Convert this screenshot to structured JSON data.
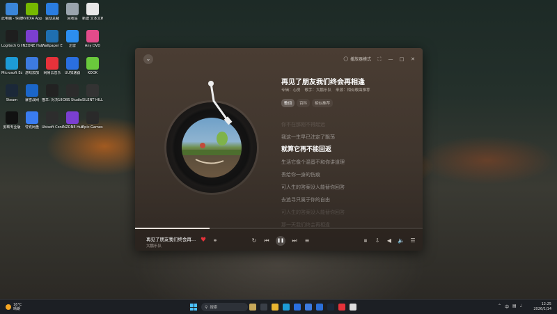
{
  "desktop": {
    "icons": [
      {
        "label": "此电脑 - 快捷方式",
        "color": "#3a86d9"
      },
      {
        "label": "NVIDIA App",
        "color": "#76b900"
      },
      {
        "label": "驱动总裁",
        "color": "#2a7de1"
      },
      {
        "label": "回收站",
        "color": "#9aa4ad"
      },
      {
        "label": "新建 文本文档",
        "color": "#e8e8e8"
      },
      {
        "label": "Logitech G HUB",
        "color": "#1e1e1e"
      },
      {
        "label": "INZONE Hub",
        "color": "#7b3fd1"
      },
      {
        "label": "Wallpaper Engine",
        "color": "#1f6fb0"
      },
      {
        "label": "迅雷",
        "color": "#2c8ef0"
      },
      {
        "label": "Any DVD",
        "color": "#e34b8a"
      },
      {
        "label": "Microsoft Edge",
        "color": "#1d9bd6"
      },
      {
        "label": "游戏加加",
        "color": "#3d7be0"
      },
      {
        "label": "网易云音乐",
        "color": "#e6323a"
      },
      {
        "label": "UU加速器",
        "color": "#2a6fe0"
      },
      {
        "label": "KOOK",
        "color": "#6ac93c"
      },
      {
        "label": "Steam",
        "color": "#1b2838"
      },
      {
        "label": "暴雪战网",
        "color": "#1b66c9"
      },
      {
        "label": "猫羊: 对决1896",
        "color": "#222222"
      },
      {
        "label": "OBS Studio",
        "color": "#2b2b2b"
      },
      {
        "label": "SILENT HILL 2",
        "color": "#333333"
      },
      {
        "label": "剪映专业版",
        "color": "#111111"
      },
      {
        "label": "夸克网盘",
        "color": "#3a7cf0"
      },
      {
        "label": "Ubisoft Connect",
        "color": "#2d2d2d"
      },
      {
        "label": "INZONE Hub",
        "color": "#7b3fd1"
      },
      {
        "label": "Epic Games Launcher",
        "color": "#2a2a2a"
      }
    ]
  },
  "player": {
    "mode_label": "播放器模式",
    "song_title": "再见了朋友我们终会再相逢",
    "album_label": "专辑：心房",
    "artist_label": "歌手：大鹏乐队",
    "source_label": "来源：相似歌曲推荐",
    "tabs": [
      {
        "label": "歌词",
        "active": true
      },
      {
        "label": "百科",
        "active": false
      },
      {
        "label": "相似推荐",
        "active": false
      }
    ],
    "lyrics": [
      {
        "text": "你不在那刚不得起远",
        "state": "fade"
      },
      {
        "text": "我这一生早已注定了飘荡",
        "state": "dim"
      },
      {
        "text": "就算它再不能回返",
        "state": "current"
      },
      {
        "text": "生活它像个混蛋不和你讲道理",
        "state": "dim"
      },
      {
        "text": "丢给你一身的伤痕",
        "state": "dim"
      },
      {
        "text": "可人生的答案没人能替你回答",
        "state": "dim"
      },
      {
        "text": "去追寻只属于你的自由",
        "state": "dim"
      },
      {
        "text": "可人生的答案没人能替你回答",
        "state": "fade"
      },
      {
        "text": "那一天我们终会再相逢",
        "state": "fade"
      }
    ],
    "bar": {
      "title": "再见了朋友我们终会再...",
      "artist": "大鹏乐队",
      "progress": 0.26
    }
  },
  "taskbar": {
    "temperature": "16°C",
    "weather": "晴朗",
    "search_placeholder": "搜索",
    "time": "12:25",
    "date": "2026/1/14",
    "ime": "中",
    "app_colors": [
      "#c8a95a",
      "#3a3f48",
      "#e8b531",
      "#1d9bd6",
      "#2a6fe0",
      "#3d7be0",
      "#2b6fd8",
      "#1b2838",
      "#e6323a",
      "#dddddd"
    ]
  }
}
